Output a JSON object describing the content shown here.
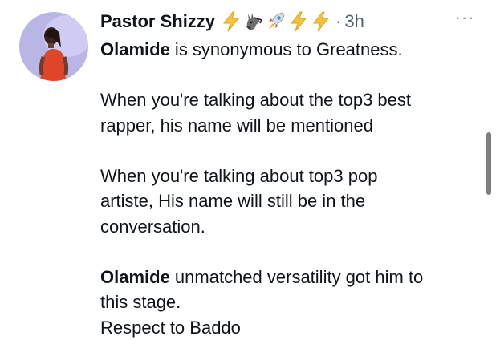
{
  "post": {
    "author": {
      "display_name": "Pastor Shizzy",
      "name_emojis": [
        "lightning-icon",
        "donkey-icon",
        "rocket-icon",
        "lightning-icon",
        "lightning-icon"
      ]
    },
    "separator": "·",
    "timestamp": "3h",
    "more_menu_glyph": "···",
    "paragraphs": [
      {
        "lines": [
          {
            "bold": "Olamide",
            "text": " is synonymous to Greatness."
          }
        ]
      },
      {
        "lines": [
          {
            "text": "When you're talking about the top3 best"
          },
          {
            "text": "rapper, his name will be mentioned"
          }
        ]
      },
      {
        "lines": [
          {
            "text": "When you're talking about top3 pop"
          },
          {
            "text": "artiste, His name will still be in the"
          },
          {
            "text": "conversation."
          }
        ]
      },
      {
        "lines": [
          {
            "bold": "Olamide",
            "text": " unmatched versatility got him to"
          },
          {
            "text": "this stage."
          },
          {
            "text": "Respect to Baddo"
          }
        ]
      }
    ]
  },
  "colors": {
    "text": "#0f1419",
    "muted": "#536471",
    "lightning": "#f5c242",
    "avatar_bg": "#b9b6e6",
    "dress": "#e0452a"
  }
}
